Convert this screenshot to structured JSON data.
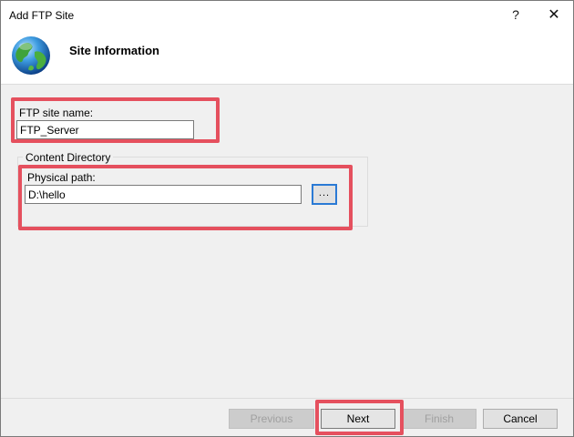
{
  "window": {
    "title": "Add FTP Site",
    "help_glyph": "?",
    "close_glyph": "✕"
  },
  "header": {
    "title": "Site Information",
    "icon": "globe-icon"
  },
  "form": {
    "site_name_label": "FTP site name:",
    "site_name_value": "FTP_Server",
    "content_directory_label": "Content Directory",
    "physical_path_label": "Physical path:",
    "physical_path_value": "D:\\hello",
    "browse_label": "..."
  },
  "footer": {
    "previous_label": "Previous",
    "next_label": "Next",
    "finish_label": "Finish",
    "cancel_label": "Cancel"
  },
  "colors": {
    "highlight": "#e5505e",
    "focus_border": "#2a7ad5",
    "dialog_bg": "#f0f0f0"
  }
}
